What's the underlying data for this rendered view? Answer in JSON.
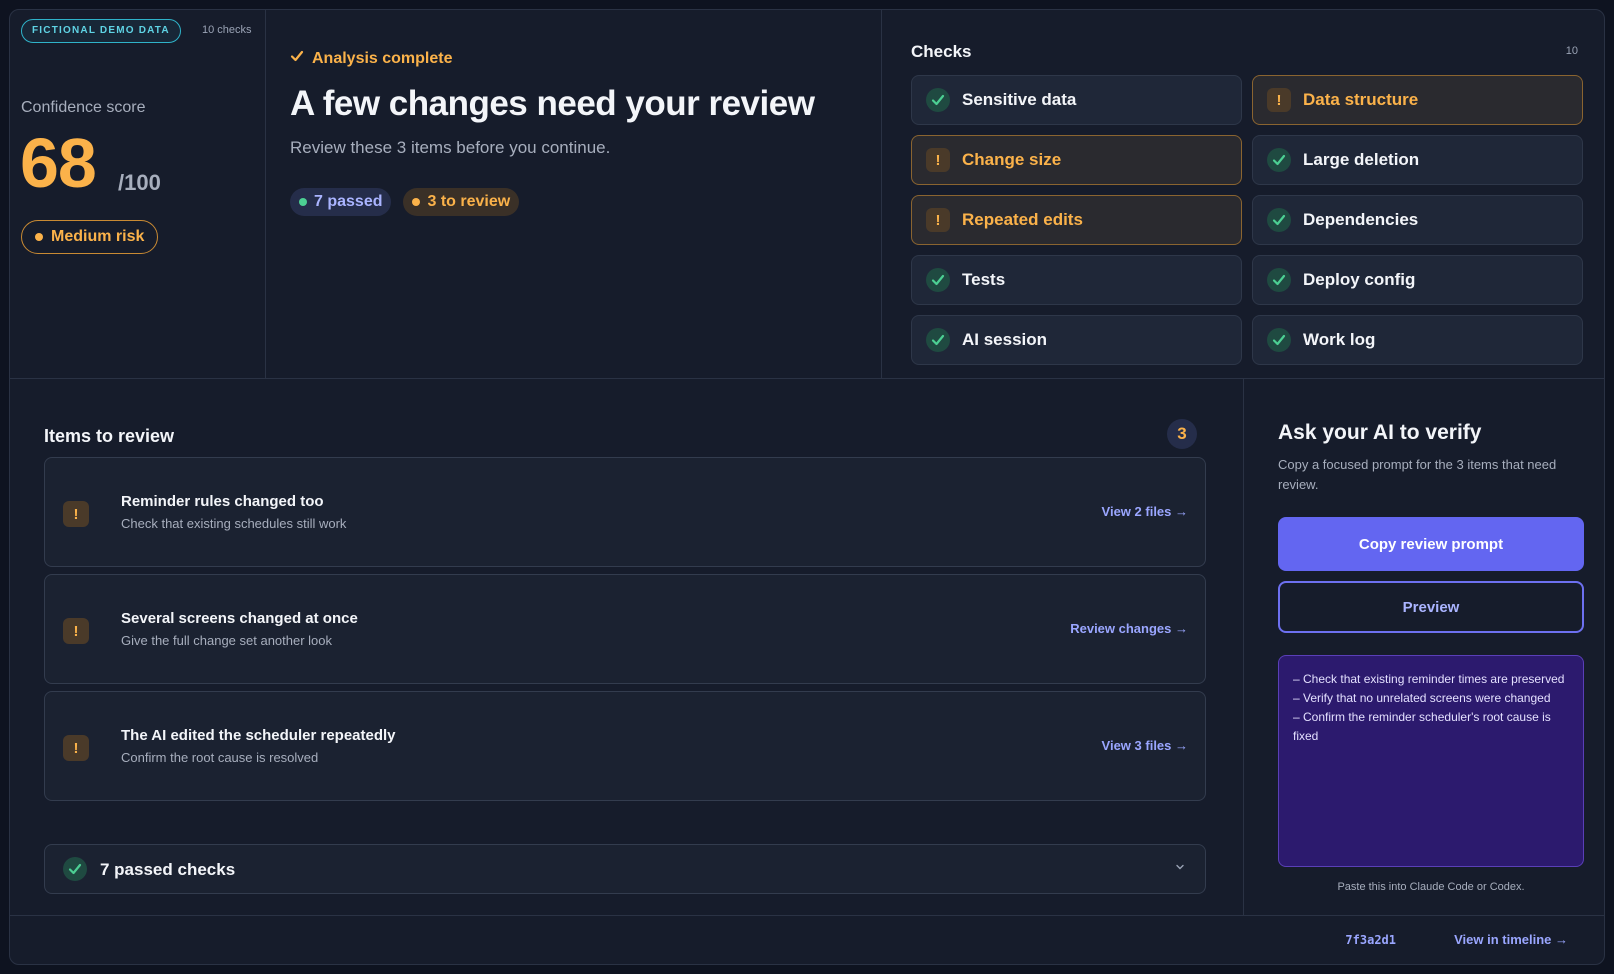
{
  "score_panel": {
    "demo_badge": "FICTIONAL DEMO DATA",
    "checks_count": "10 checks",
    "confidence_label": "Confidence score",
    "score": "68",
    "score_max": "/100",
    "risk": "Medium risk"
  },
  "summary": {
    "status": "Analysis complete",
    "headline": "A few changes need your review",
    "subline": "Review these 3 items before you continue.",
    "passed_pill": "7 passed",
    "review_pill": "3 to review"
  },
  "checks": {
    "title": "Checks",
    "total": "10",
    "items": [
      {
        "label": "Sensitive data",
        "status": "pass"
      },
      {
        "label": "Data structure",
        "status": "warn"
      },
      {
        "label": "Change size",
        "status": "warn"
      },
      {
        "label": "Large deletion",
        "status": "pass"
      },
      {
        "label": "Repeated edits",
        "status": "warn"
      },
      {
        "label": "Dependencies",
        "status": "pass"
      },
      {
        "label": "Tests",
        "status": "pass"
      },
      {
        "label": "Deploy config",
        "status": "pass"
      },
      {
        "label": "AI session",
        "status": "pass"
      },
      {
        "label": "Work log",
        "status": "pass"
      }
    ]
  },
  "review": {
    "title": "Items to review",
    "count": "3",
    "items": [
      {
        "title": "Reminder rules changed too",
        "subtitle": "Check that existing schedules still work",
        "link": "View 2 files →"
      },
      {
        "title": "Several screens changed at once",
        "subtitle": "Give the full change set another look",
        "link": "Review changes →"
      },
      {
        "title": "The AI edited the scheduler repeatedly",
        "subtitle": "Confirm the root cause is resolved",
        "link": "View 3 files →"
      }
    ],
    "passed_label": "7 passed checks"
  },
  "ai_verify": {
    "title": "Ask your AI to verify",
    "description": "Copy a focused prompt for the 3 items that need review.",
    "copy_button": "Copy review prompt",
    "preview_button": "Preview",
    "prompt_lines": [
      "– Check that existing reminder times are preserved",
      "– Verify that no unrelated screens were changed",
      "– Confirm the reminder scheduler's root cause is fixed"
    ],
    "paste_note": "Paste this into Claude Code or Codex."
  },
  "footer": {
    "commit": "7f3a2d1",
    "timeline_link": "View in timeline →"
  },
  "colors": {
    "accent": "#6366f1",
    "warning": "#fbb24a",
    "success": "#4ccf93",
    "info": "#5fd3e4"
  }
}
